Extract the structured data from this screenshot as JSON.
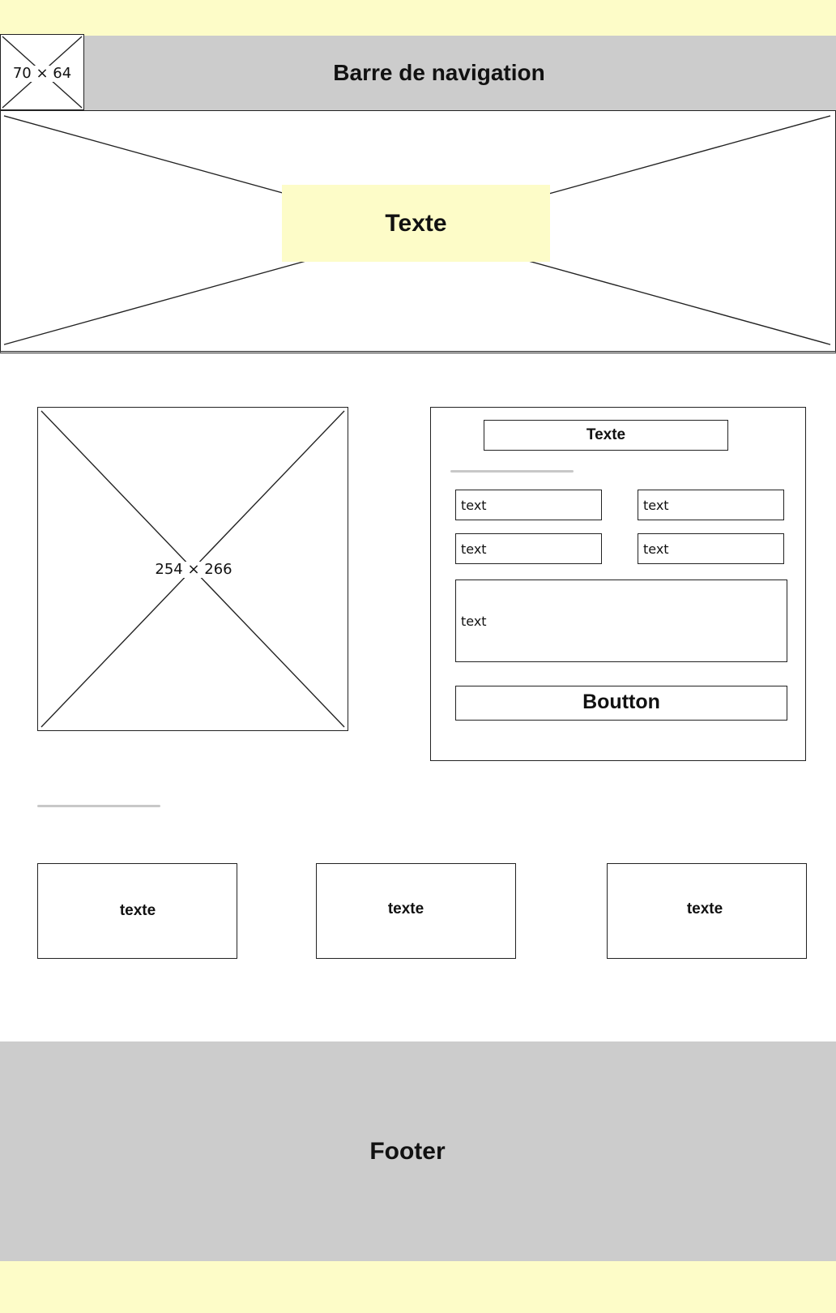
{
  "colors": {
    "band": "#fdfcc8",
    "navbar": "#cccccc",
    "footer": "#cccccc",
    "hero_box": "#fdfcc8",
    "separator": "#c8c8c8"
  },
  "header": {
    "logo_placeholder": "70 × 64",
    "navbar_label": "Barre de navigation"
  },
  "hero": {
    "text": "Texte"
  },
  "main": {
    "image_placeholder": "254 × 266",
    "form": {
      "title": "Texte",
      "fields": [
        "text",
        "text",
        "text",
        "text"
      ],
      "textarea": "text",
      "button_label": "Boutton"
    }
  },
  "cards": [
    "texte",
    "texte",
    "texte"
  ],
  "footer": {
    "label": "Footer"
  }
}
